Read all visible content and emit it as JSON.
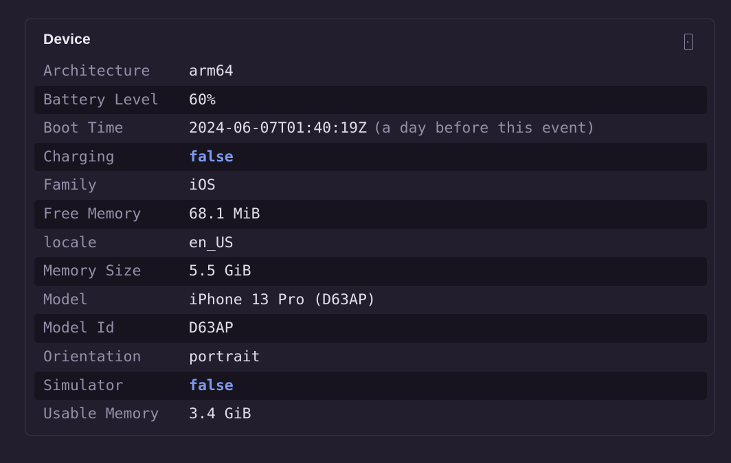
{
  "panel": {
    "title": "Device",
    "icon": "mobile-device-icon"
  },
  "colors": {
    "background": "#231e2d",
    "stripe": "#18141f",
    "key": "#958ea8",
    "value": "#e2dde9",
    "boolean": "#7c9bf0"
  },
  "rows": [
    {
      "key": "Architecture",
      "value": "arm64"
    },
    {
      "key": "Battery Level",
      "value": "60%"
    },
    {
      "key": "Boot Time",
      "value": "2024-06-07T01:40:19Z",
      "relative": "(a day before this event)"
    },
    {
      "key": "Charging",
      "value": "false"
    },
    {
      "key": "Family",
      "value": "iOS"
    },
    {
      "key": "Free Memory",
      "value": "68.1 MiB"
    },
    {
      "key": "locale",
      "value": "en_US"
    },
    {
      "key": "Memory Size",
      "value": "5.5 GiB"
    },
    {
      "key": "Model",
      "value": "iPhone 13 Pro (D63AP)"
    },
    {
      "key": "Model Id",
      "value": "D63AP"
    },
    {
      "key": "Orientation",
      "value": "portrait"
    },
    {
      "key": "Simulator",
      "value": "false"
    },
    {
      "key": "Usable Memory",
      "value": "3.4 GiB"
    }
  ]
}
